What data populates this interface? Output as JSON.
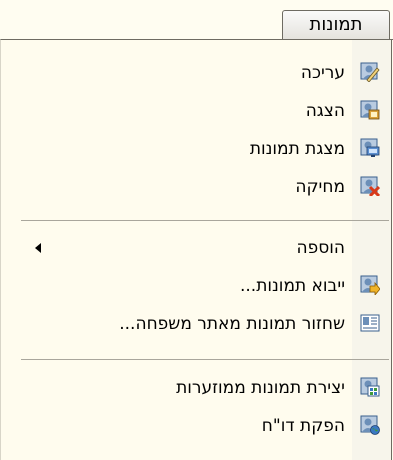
{
  "menu": {
    "title": "תמונות",
    "items": [
      {
        "label": "עריכה",
        "icon": "edit-photo-icon"
      },
      {
        "label": "הצגה",
        "icon": "view-photo-icon"
      },
      {
        "label": "מצגת תמונות",
        "icon": "slideshow-icon"
      },
      {
        "label": "מחיקה",
        "icon": "delete-photo-icon"
      },
      {
        "label": "הוספה",
        "icon": "",
        "has_submenu": true
      },
      {
        "label": "ייבוא תמונות...",
        "icon": "import-photos-icon"
      },
      {
        "label": "שחזור תמונות מאתר משפחה...",
        "icon": "restore-photos-icon"
      },
      {
        "label": "יצירת תמונות ממוזערות",
        "icon": "thumbnails-icon"
      },
      {
        "label": "הפקת דו\"ח",
        "icon": "report-icon"
      }
    ]
  },
  "colors": {
    "menu_background": "#fffcee",
    "icon_column": "#f7f5eb",
    "separator": "#a9a69c",
    "icon_blue": "#3a78c2",
    "icon_green": "#3e9a38",
    "delete_red": "#d83a1a"
  }
}
